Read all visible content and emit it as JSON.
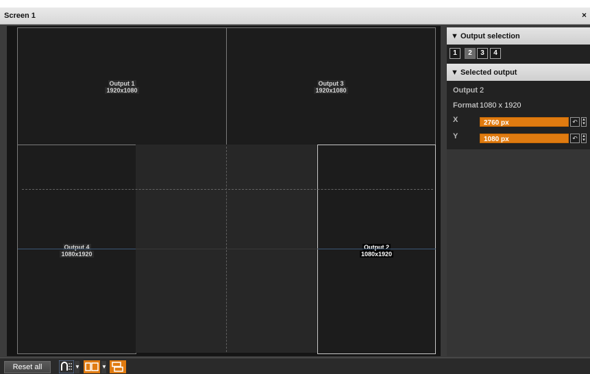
{
  "window": {
    "title": "Screen 1",
    "close_glyph": "×"
  },
  "outputs": [
    {
      "name": "Output 1",
      "format": "1920x1080"
    },
    {
      "name": "Output 3",
      "format": "1920x1080"
    },
    {
      "name": "Output 4",
      "format": "1080x1920"
    },
    {
      "name": "Output 2",
      "format": "1080x1920"
    }
  ],
  "panel": {
    "output_selection": {
      "header": "▼ Output selection",
      "buttons": [
        "1",
        "2",
        "3",
        "4"
      ],
      "active": "2"
    },
    "selected_output": {
      "header": "▼ Selected output",
      "output_label": "Output",
      "output_value": "2",
      "format_label": "Format",
      "format_value": "1080 x 1920",
      "x_label": "X",
      "x_value": "2760 px",
      "y_label": "Y",
      "y_value": "1080 px"
    }
  },
  "toolbar": {
    "reset_all_label": "Reset all",
    "icons": [
      "snap-grid-icon",
      "layout-icon",
      "stack-icon"
    ]
  },
  "colors": {
    "accent": "#e07b10",
    "background": "#151515",
    "panel": "#222222"
  }
}
